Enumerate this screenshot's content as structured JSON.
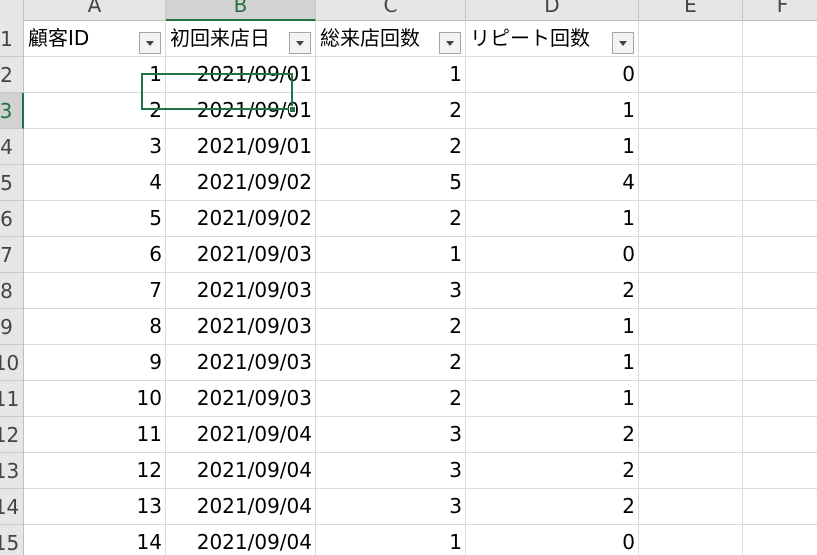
{
  "columns": [
    "A",
    "B",
    "C",
    "D",
    "E",
    "F"
  ],
  "selected_column": "B",
  "selected_row": "3",
  "rows": [
    "1",
    "2",
    "3",
    "4",
    "5",
    "6",
    "7",
    "8",
    "9",
    "10",
    "11",
    "12",
    "13",
    "14",
    "15"
  ],
  "row_labels_visible": [
    "1",
    "2",
    "3",
    "4",
    "5",
    "6",
    "7",
    "8",
    "9",
    "10",
    "11",
    "12",
    "13",
    "14",
    "15"
  ],
  "header": {
    "customer_id": "顧客ID",
    "first_visit_date": "初回来店日",
    "total_visits": "総来店回数",
    "repeat_count": "リピート回数"
  },
  "data_rows": [
    {
      "id": "1",
      "date": "2021/09/01",
      "visits": "1",
      "repeat": "0"
    },
    {
      "id": "2",
      "date": "2021/09/01",
      "visits": "2",
      "repeat": "1"
    },
    {
      "id": "3",
      "date": "2021/09/01",
      "visits": "2",
      "repeat": "1"
    },
    {
      "id": "4",
      "date": "2021/09/02",
      "visits": "5",
      "repeat": "4"
    },
    {
      "id": "5",
      "date": "2021/09/02",
      "visits": "2",
      "repeat": "1"
    },
    {
      "id": "6",
      "date": "2021/09/03",
      "visits": "1",
      "repeat": "0"
    },
    {
      "id": "7",
      "date": "2021/09/03",
      "visits": "3",
      "repeat": "2"
    },
    {
      "id": "8",
      "date": "2021/09/03",
      "visits": "2",
      "repeat": "1"
    },
    {
      "id": "9",
      "date": "2021/09/03",
      "visits": "2",
      "repeat": "1"
    },
    {
      "id": "10",
      "date": "2021/09/03",
      "visits": "2",
      "repeat": "1"
    },
    {
      "id": "11",
      "date": "2021/09/04",
      "visits": "3",
      "repeat": "2"
    },
    {
      "id": "12",
      "date": "2021/09/04",
      "visits": "3",
      "repeat": "2"
    },
    {
      "id": "13",
      "date": "2021/09/04",
      "visits": "3",
      "repeat": "2"
    },
    {
      "id": "14",
      "date": "2021/09/04",
      "visits": "1",
      "repeat": "0"
    }
  ],
  "icons": {
    "filter": "filter-dropdown-icon"
  },
  "colors": {
    "accent": "#217346",
    "header_bg": "#e6e6e6",
    "gridline": "#dadada"
  }
}
